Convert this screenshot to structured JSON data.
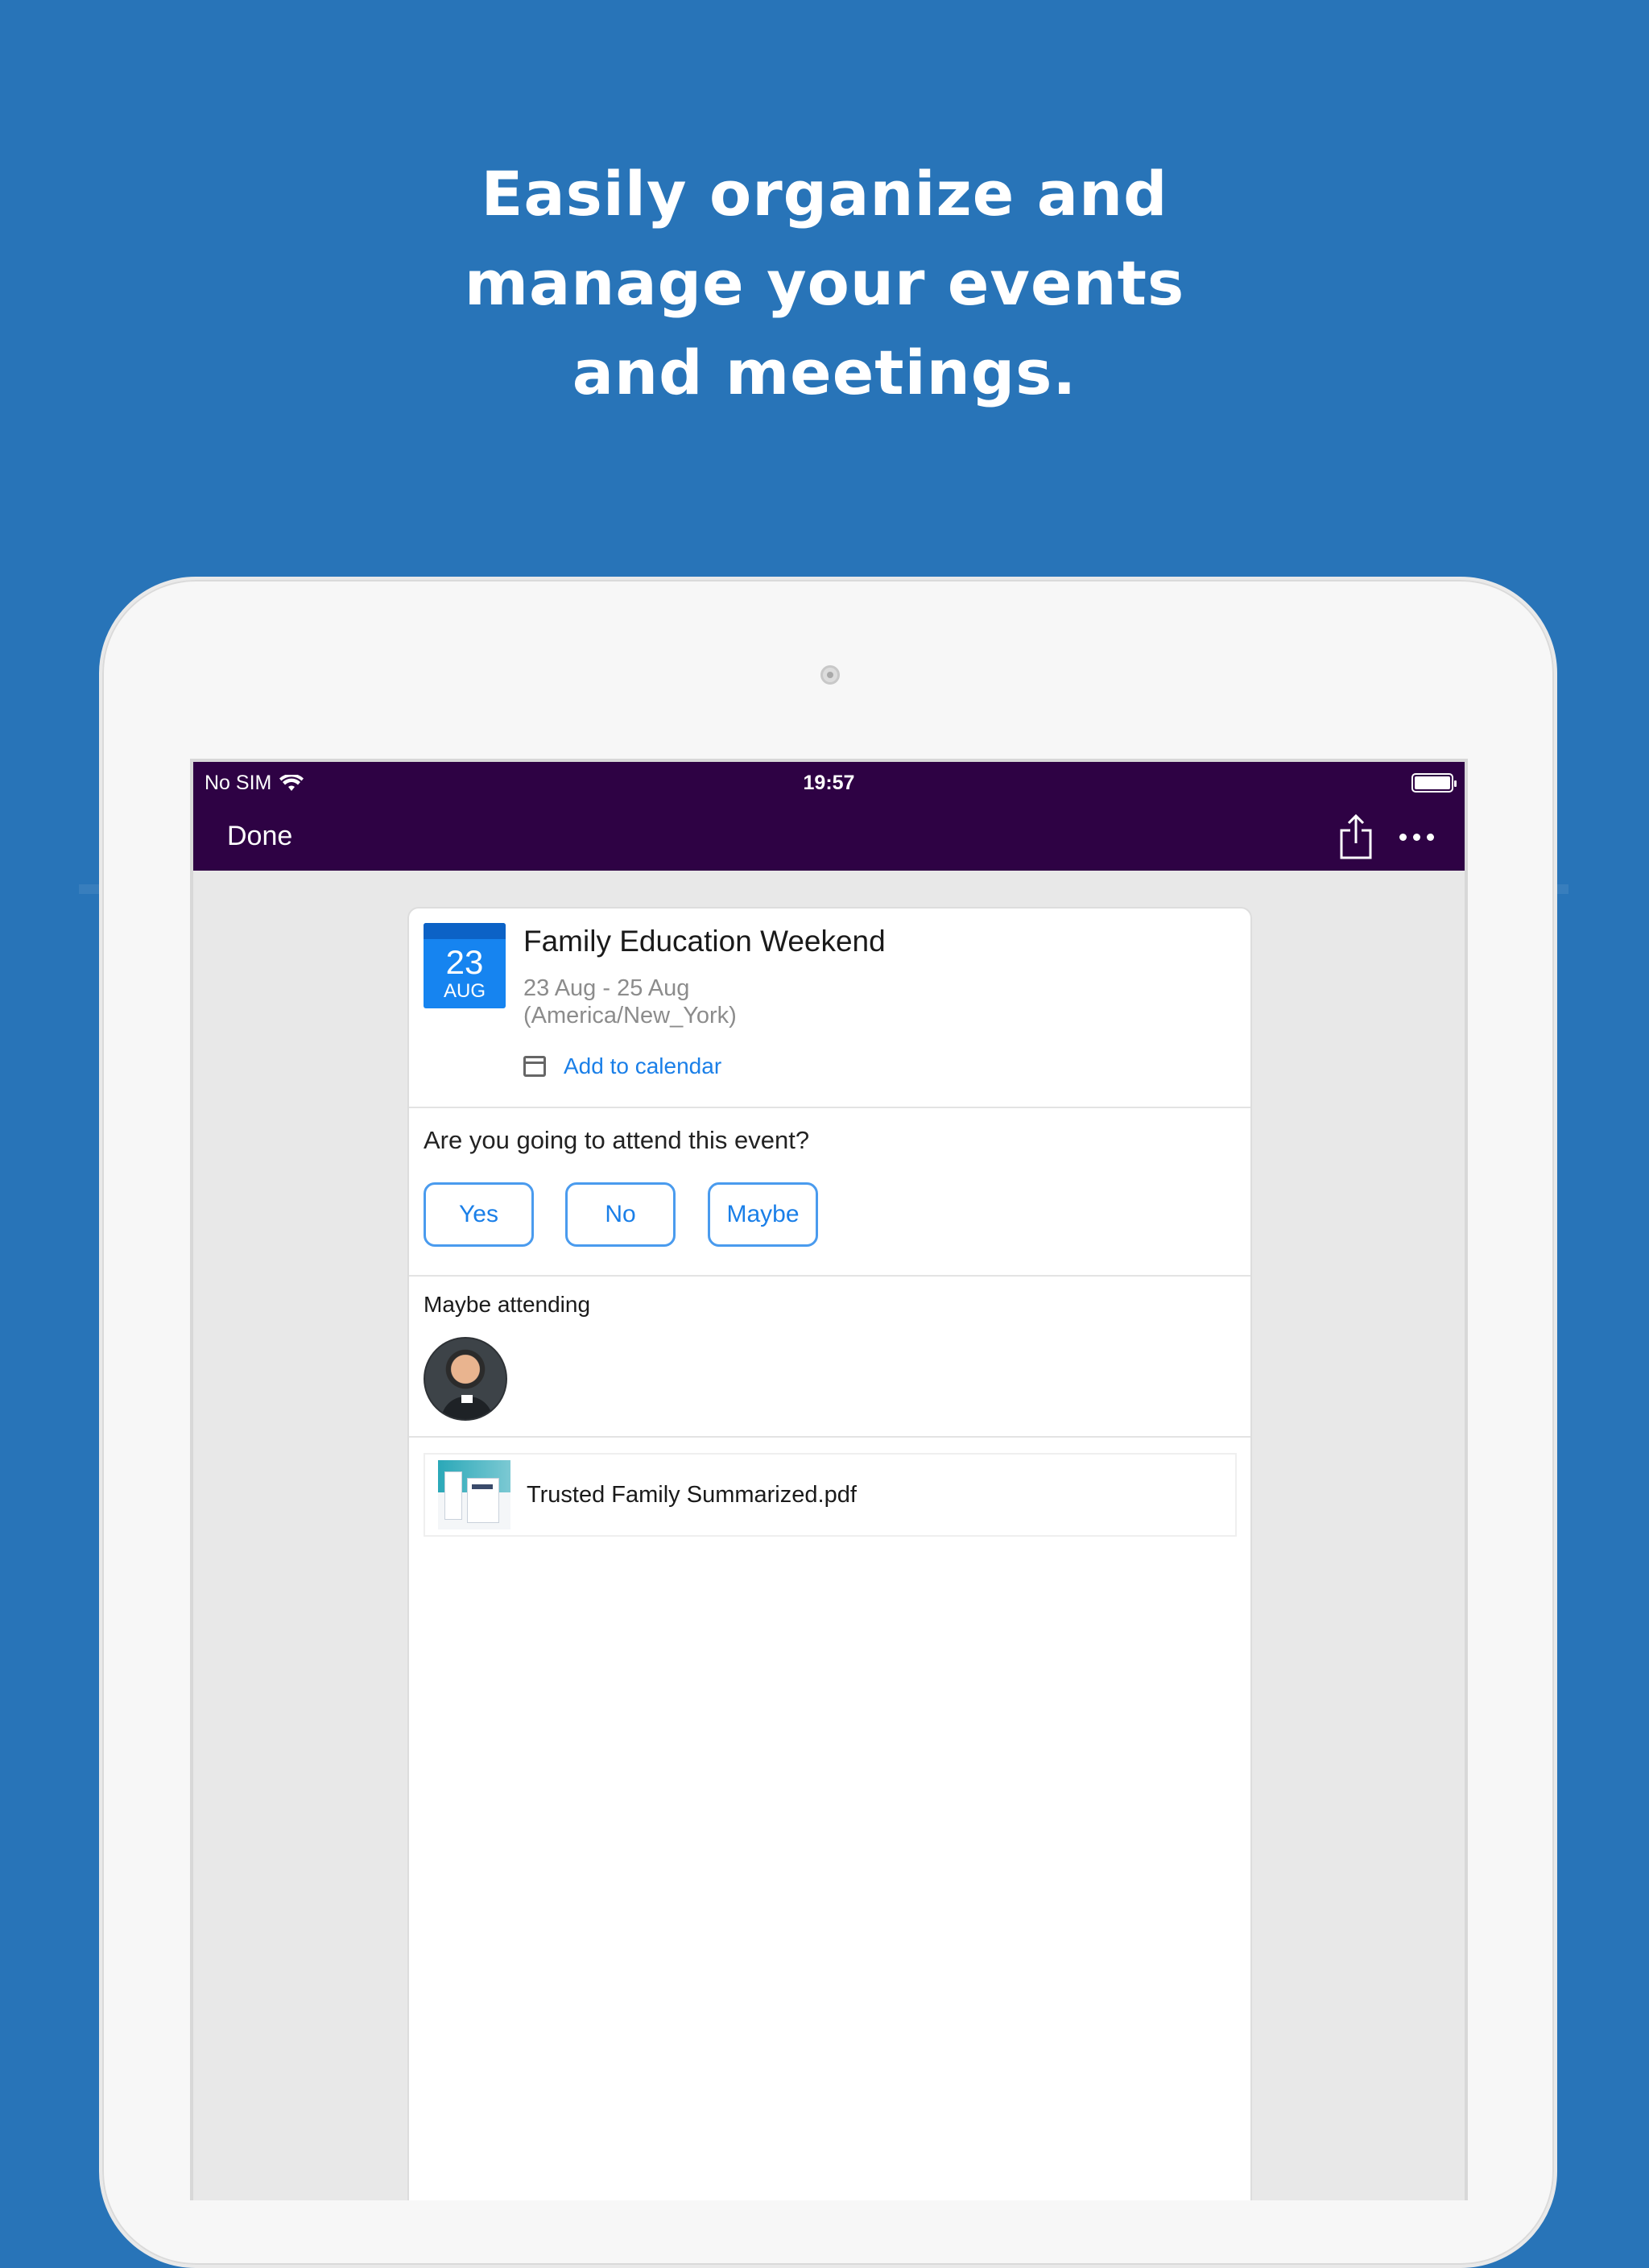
{
  "headline": {
    "line1": "Easily organize and",
    "line2": "manage your events",
    "line3": "and meetings."
  },
  "status_bar": {
    "carrier": "No SIM",
    "time": "19:57",
    "wifi_icon": "wifi-icon",
    "battery_icon": "battery-icon"
  },
  "nav": {
    "done_label": "Done",
    "share_icon": "share-icon",
    "more_icon": "more-icon"
  },
  "event": {
    "day": "23",
    "month": "AUG",
    "title": "Family Education Weekend",
    "dates": "23 Aug - 25 Aug",
    "timezone": "(America/New_York)",
    "add_to_calendar": "Add to calendar"
  },
  "rsvp": {
    "question": "Are you going to attend this event?",
    "options": [
      "Yes",
      "No",
      "Maybe"
    ]
  },
  "attendees": {
    "label": "Maybe attending"
  },
  "attachment": {
    "file_name": "Trusted Family Summarized.pdf"
  },
  "colors": {
    "background": "#2874B8",
    "header": "#2E0244",
    "accent": "#1A7FE8"
  }
}
